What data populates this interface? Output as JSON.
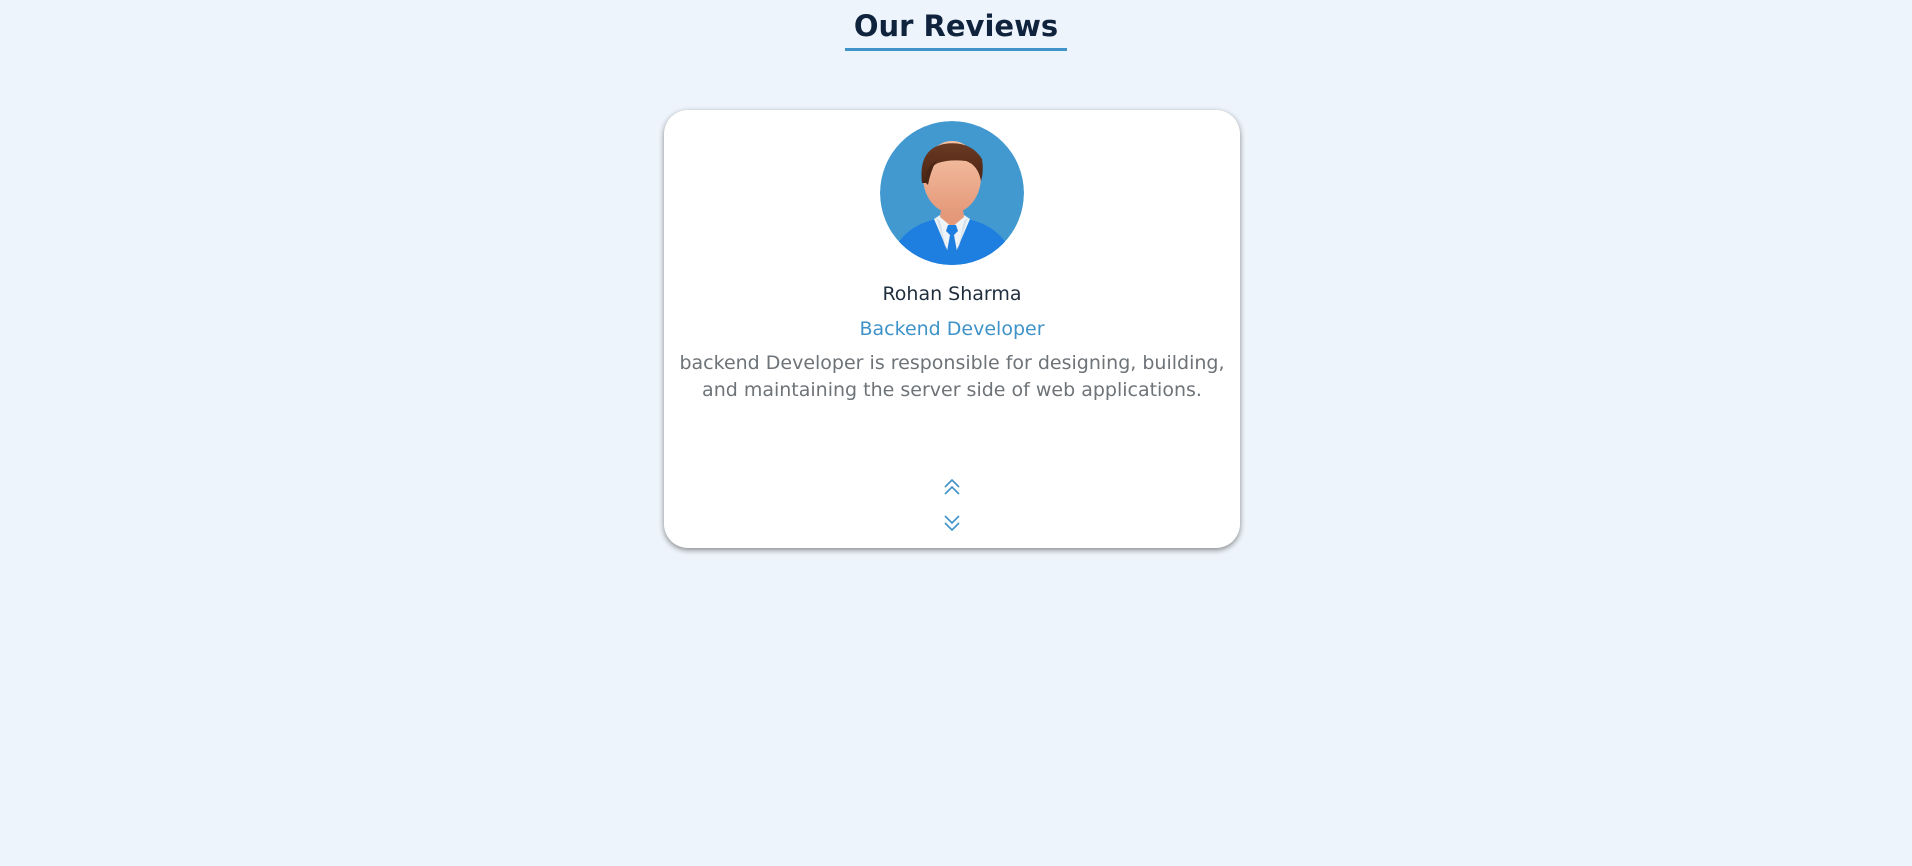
{
  "header": {
    "title": "Our Reviews"
  },
  "review": {
    "avatar_icon": "user-avatar-icon",
    "name": "Rohan Sharma",
    "role": "Backend Developer",
    "text": "backend Developer is responsible for designing, building, and maintaining the server side of web applications."
  },
  "controls": {
    "up_icon": "double-chevron-up-icon",
    "down_icon": "double-chevron-down-icon"
  },
  "colors": {
    "background": "#eef4fb",
    "accent": "#3f93c9",
    "title": "#10233d",
    "text_muted": "#6e7378"
  }
}
